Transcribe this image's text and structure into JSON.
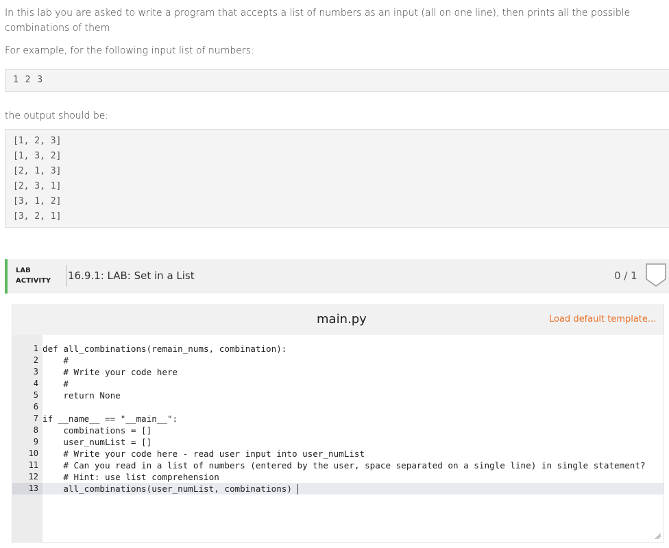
{
  "intro": {
    "paragraph1_line1": "In this lab you are asked to write a program that accepts a list of numbers as an input (all on one line), then prints all the possible",
    "paragraph1_line2": "combinations of them",
    "paragraph2": "For example, for the following input list of numbers:",
    "paragraph3": "the output should be:"
  },
  "example_input": "1 2 3",
  "example_output": [
    "[1, 2, 3]",
    "[1, 3, 2]",
    "[2, 1, 3]",
    "[2, 3, 1]",
    "[3, 1, 2]",
    "[3, 2, 1]"
  ],
  "lab": {
    "tag_line1": "LAB",
    "tag_line2": "ACTIVITY",
    "title": "16.9.1: LAB: Set in a List",
    "score": "0 / 1",
    "accent_color": "#5cb85c"
  },
  "editor": {
    "filename": "main.py",
    "load_template_label": "Load default template...",
    "link_color": "#e8722a",
    "line_numbers": [
      "1",
      "2",
      "3",
      "4",
      "5",
      "6",
      "7",
      "8",
      "9",
      "10",
      "11",
      "12",
      "13"
    ],
    "code": [
      "def all_combinations(remain_nums, combination):",
      "    #",
      "    # Write your code here",
      "    #",
      "    return None",
      "",
      "if __name__ == \"__main__\":",
      "    combinations = []",
      "    user_numList = []",
      "    # Write your code here - read user input into user_numList",
      "    # Can you read in a list of numbers (entered by the user, space separated on a single line) in single statement?",
      "    # Hint: use list comprehension",
      "    all_combinations(user_numList, combinations)"
    ]
  }
}
